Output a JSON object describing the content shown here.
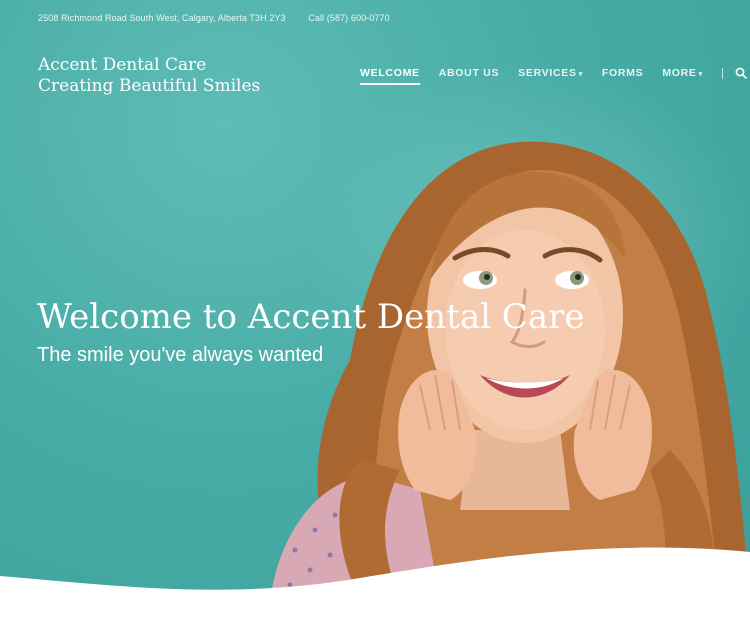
{
  "topbar": {
    "address": "2508 Richmond Road South West, Calgary, Alberta T3H 2Y3",
    "phone": "Call (587) 600-0770"
  },
  "brand": {
    "name": "Accent Dental Care",
    "tagline": "Creating Beautiful Smiles"
  },
  "nav": {
    "items": [
      {
        "label": "WELCOME",
        "active": true
      },
      {
        "label": "ABOUT US"
      },
      {
        "label": "SERVICES",
        "dropdown": true
      },
      {
        "label": "FORMS"
      },
      {
        "label": "MORE",
        "dropdown": true
      }
    ],
    "search_icon": "search-icon"
  },
  "hero": {
    "title": "Welcome to Accent Dental Care",
    "subtitle": "The smile you've always wanted"
  },
  "colors": {
    "hero_teal": "#48aca6",
    "text_white": "#ffffff"
  }
}
